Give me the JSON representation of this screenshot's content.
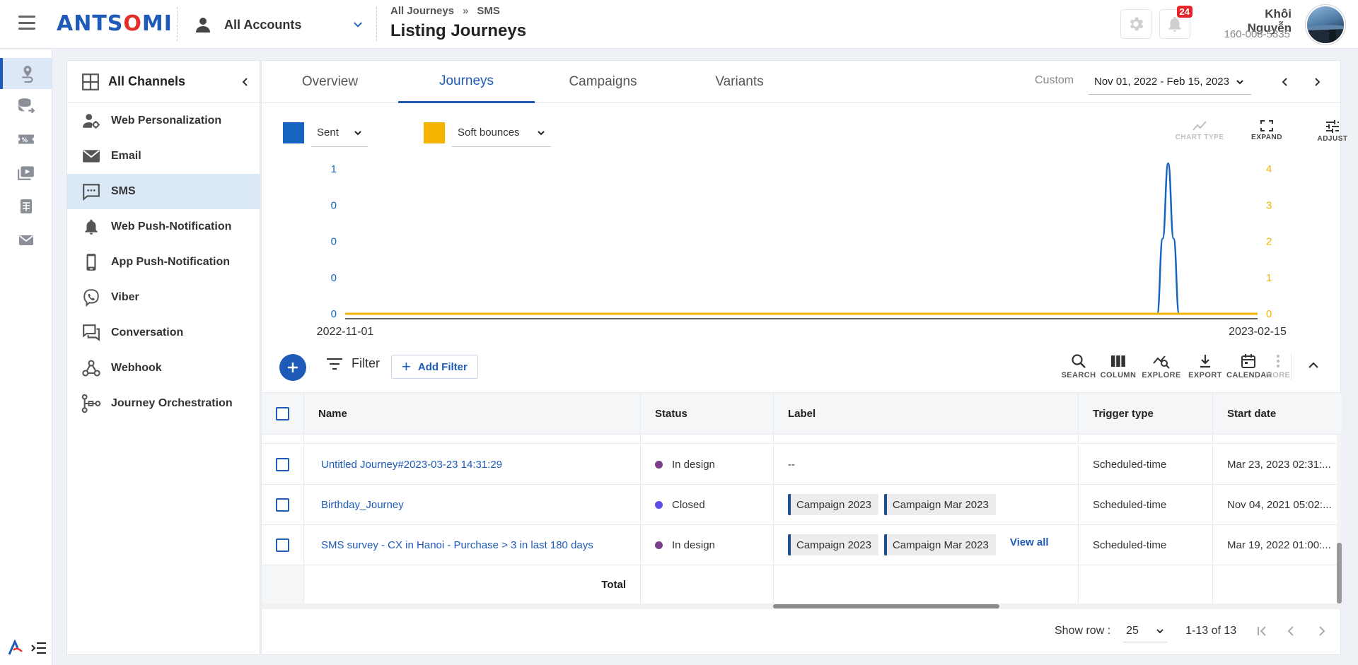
{
  "brand": {
    "logo_left": "A",
    "logo_mid": "NTS",
    "logo_o": "O",
    "logo_right": "MI"
  },
  "header": {
    "account": "All Accounts",
    "breadcrumb": [
      "All Journeys",
      "SMS"
    ],
    "breadcrumb_sep": "»",
    "title": "Listing Journeys",
    "notifications_count": "24",
    "user_name": "Khôi Nguyễn",
    "user_phone": "160-008-5335"
  },
  "rail": {
    "icons": [
      "journey-icon",
      "data-icon",
      "ticket-icon",
      "media-icon",
      "table-icon",
      "mail-icon"
    ]
  },
  "channels": {
    "title": "All Channels",
    "items": [
      {
        "label": "Web Personalization",
        "icon": "user-gear-icon"
      },
      {
        "label": "Email",
        "icon": "email-icon"
      },
      {
        "label": "SMS",
        "icon": "sms-icon"
      },
      {
        "label": "Web Push-Notification",
        "icon": "bell-icon"
      },
      {
        "label": "App Push-Notification",
        "icon": "phone-icon"
      },
      {
        "label": "Viber",
        "icon": "viber-icon"
      },
      {
        "label": "Conversation",
        "icon": "conversation-icon"
      },
      {
        "label": "Webhook",
        "icon": "webhook-icon"
      },
      {
        "label": "Journey Orchestration",
        "icon": "orchestration-icon"
      }
    ],
    "active": "SMS"
  },
  "tabs": [
    "Overview",
    "Journeys",
    "Campaigns",
    "Variants"
  ],
  "active_tab": "Journeys",
  "date": {
    "custom_label": "Custom",
    "range": "Nov 01, 2022 - Feb 15, 2023"
  },
  "chart_controls": {
    "metric_left": "Sent",
    "metric_right": "Soft bounces",
    "color_left": "#1565c0",
    "color_right": "#f4b400",
    "tools": [
      "CHART TYPE",
      "EXPAND",
      "ADJUST"
    ]
  },
  "chart_data": {
    "type": "line",
    "x_start_label": "2022-11-01",
    "x_end_label": "2023-02-15",
    "y_left_ticks": [
      "1",
      "0",
      "0",
      "0",
      "0"
    ],
    "y_right_ticks": [
      "4",
      "3",
      "2",
      "1",
      "0"
    ],
    "series": [
      {
        "name": "Sent",
        "color": "#1565c0",
        "axis": "left",
        "points": [
          [
            0,
            0
          ],
          [
            0.89,
            0
          ],
          [
            0.896,
            0.5
          ],
          [
            0.902,
            1
          ],
          [
            0.908,
            0.5
          ],
          [
            0.914,
            0
          ],
          [
            1,
            0
          ]
        ]
      },
      {
        "name": "Soft bounces",
        "color": "#f4b400",
        "axis": "right",
        "points": [
          [
            0,
            0
          ],
          [
            1,
            0
          ]
        ]
      }
    ]
  },
  "toolbar": {
    "filter": "Filter",
    "add_filter": "Add Filter",
    "tools": [
      "SEARCH",
      "COLUMN",
      "EXPLORE",
      "EXPORT",
      "CALENDAR",
      "MORE"
    ]
  },
  "table": {
    "columns": [
      "Name",
      "Status",
      "Label",
      "Trigger type",
      "Start date"
    ],
    "rows": [
      {
        "name": "Untitled Journey#2023-03-23 14:31:29",
        "status": "In design",
        "status_color": "#7b3f8c",
        "labels": [],
        "label_text": "--",
        "view_all": "",
        "trigger": "Scheduled-time",
        "start": "Mar 23, 2023 02:31:..."
      },
      {
        "name": "Birthday_Journey",
        "status": "Closed",
        "status_color": "#5b4ee6",
        "labels": [
          "Campaign 2023",
          "Campaign Mar 2023"
        ],
        "label_text": "",
        "view_all": "",
        "trigger": "Scheduled-time",
        "start": "Nov 04, 2021 05:02:..."
      },
      {
        "name": "SMS survey - CX in Hanoi - Purchase > 3 in last 180 days",
        "status": "In design",
        "status_color": "#7b3f8c",
        "labels": [
          "Campaign 2023",
          "Campaign Mar 2023"
        ],
        "label_text": "",
        "view_all": "View all",
        "trigger": "Scheduled-time",
        "start": "Mar 19, 2022 01:00:..."
      }
    ],
    "total_label": "Total"
  },
  "pagination": {
    "show_row_label": "Show row :",
    "rows": "25",
    "range": "1-13 of 13"
  }
}
